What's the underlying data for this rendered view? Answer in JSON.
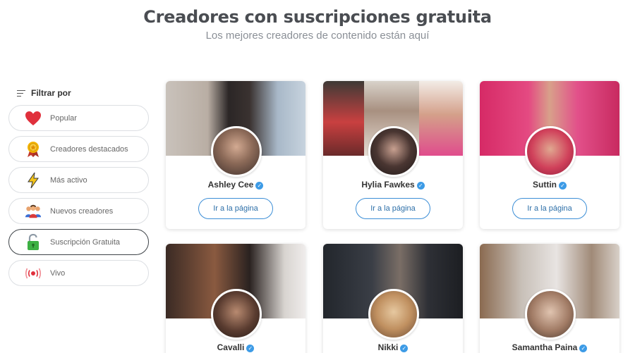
{
  "header": {
    "title": "Creadores con suscripciones gratuita",
    "subtitle": "Los mejores creadores de contenido están aquí"
  },
  "sidebar": {
    "filter_label": "Filtrar por",
    "items": [
      {
        "label": "Popular",
        "icon": "heart-icon",
        "active": false
      },
      {
        "label": "Creadores destacados",
        "icon": "medal-icon",
        "active": false
      },
      {
        "label": "Más activo",
        "icon": "lightning-icon",
        "active": false
      },
      {
        "label": "Nuevos creadores",
        "icon": "people-icon",
        "active": false
      },
      {
        "label": "Suscripción Gratuita",
        "icon": "unlock-icon",
        "active": true
      },
      {
        "label": "Vivo",
        "icon": "live-icon",
        "active": false
      }
    ]
  },
  "creators": [
    {
      "name": "Ashley Cee",
      "button": "Ir a la página",
      "verified": true
    },
    {
      "name": "Hylia Fawkes",
      "button": "Ir a la página",
      "verified": true
    },
    {
      "name": "Suttin",
      "button": "Ir a la página",
      "verified": true
    },
    {
      "name": "Cavalli",
      "verified": true
    },
    {
      "name": "Nikki",
      "verified": true
    },
    {
      "name": "Samantha Paina",
      "verified": true
    }
  ],
  "colors": {
    "accent": "#3c8ed6",
    "verified": "#3d9be6",
    "title": "#4a4d52",
    "subtitle": "#8a8f96"
  }
}
